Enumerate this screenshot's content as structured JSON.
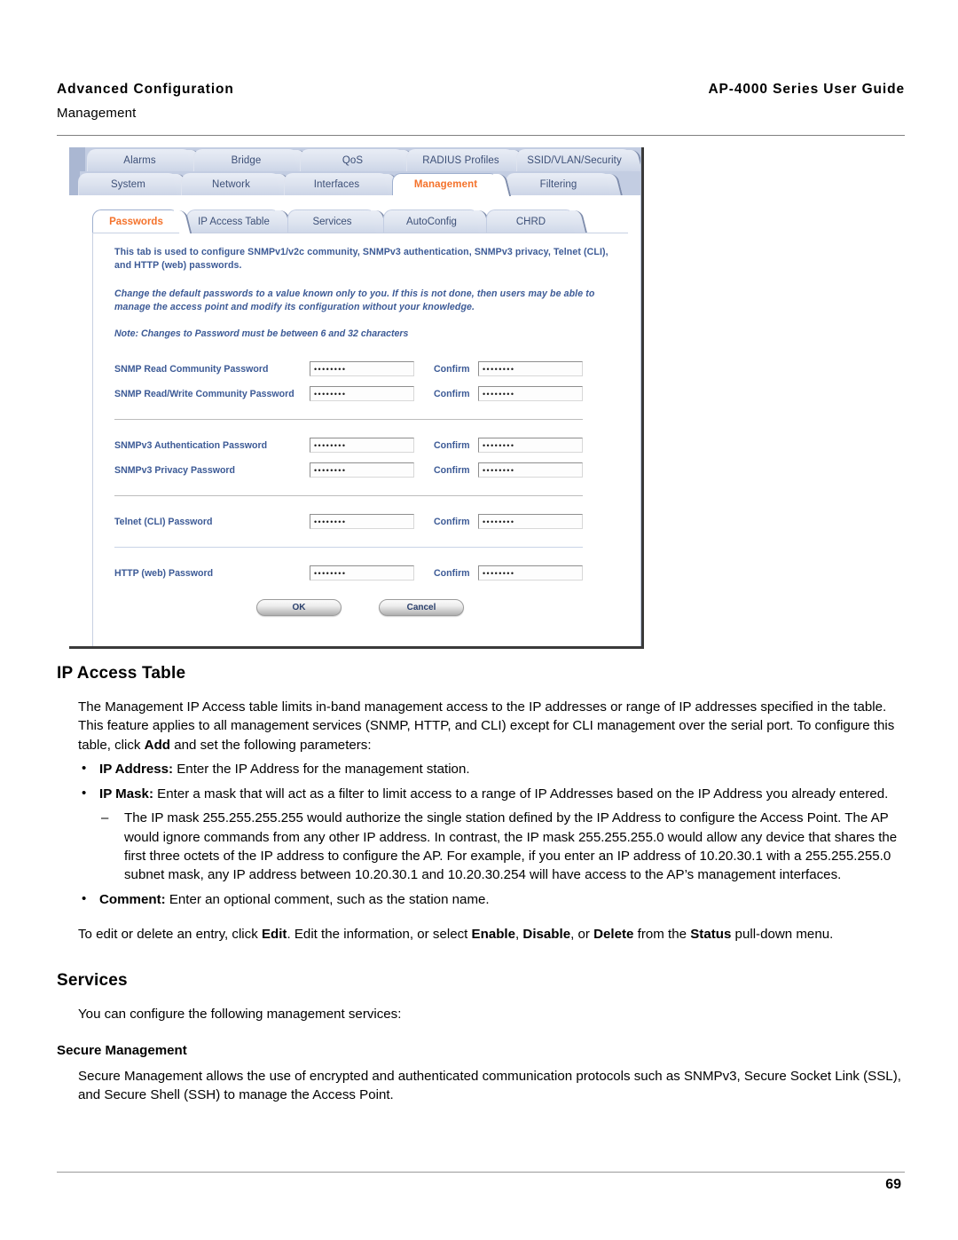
{
  "header": {
    "left_title": "Advanced Configuration",
    "left_sub": "Management",
    "right_title": "AP-4000 Series User Guide"
  },
  "screenshot": {
    "tabs_row1": [
      {
        "label": "Alarms",
        "active": false
      },
      {
        "label": "Bridge",
        "active": false
      },
      {
        "label": "QoS",
        "active": false
      },
      {
        "label": "RADIUS Profiles",
        "active": false
      },
      {
        "label": "SSID/VLAN/Security",
        "active": false
      }
    ],
    "tabs_row2": [
      {
        "label": "System",
        "active": false
      },
      {
        "label": "Network",
        "active": false
      },
      {
        "label": "Interfaces",
        "active": false
      },
      {
        "label": "Management",
        "active": true
      },
      {
        "label": "Filtering",
        "active": false
      }
    ],
    "subtabs": [
      {
        "label": "Passwords",
        "active": true
      },
      {
        "label": "IP Access Table",
        "active": false
      },
      {
        "label": "Services",
        "active": false
      },
      {
        "label": "AutoConfig",
        "active": false
      },
      {
        "label": "CHRD",
        "active": false
      }
    ],
    "description": "This tab is used to configure SNMPv1/v2c community, SNMPv3 authentication, SNMPv3 privacy, Telnet (CLI), and HTTP (web) passwords.",
    "warning": "Change the default passwords to a value known only to you. If this is not done, then users may be able to manage the access point and modify its configuration without your knowledge.",
    "note": "Note: Changes to Password must be between 6 and 32 characters",
    "confirm_label": "Confirm",
    "masked_value": "••••••••",
    "fields_group1": [
      {
        "label": "SNMP Read Community Password"
      },
      {
        "label": "SNMP Read/Write Community Password"
      }
    ],
    "fields_group2": [
      {
        "label": "SNMPv3 Authentication Password"
      },
      {
        "label": "SNMPv3 Privacy Password"
      }
    ],
    "fields_group3": [
      {
        "label": "Telnet (CLI) Password"
      }
    ],
    "fields_group4": [
      {
        "label": "HTTP (web) Password"
      }
    ],
    "buttons": {
      "ok": "OK",
      "cancel": "Cancel"
    },
    "accent_active_tab_color": "#f4722b",
    "tab_text_color": "#3c4f77",
    "form_label_color": "#3c5a96"
  },
  "content": {
    "ip_access_heading": "IP Access Table",
    "ip_access_intro_1": "The Management IP Access table limits in-band management access to the IP addresses or range of IP addresses specified in the table. This feature applies to all management services (SNMP, HTTP, and CLI) except for CLI management over the serial port. To configure this table, click ",
    "ip_access_intro_bold": "Add",
    "ip_access_intro_2": " and set the following parameters:",
    "bullet_ip_address_label": "IP Address:",
    "bullet_ip_address_text": " Enter the IP Address for the management station.",
    "bullet_ip_mask_label": "IP Mask:",
    "bullet_ip_mask_text": " Enter a mask that will act as a filter to limit access to a range of IP Addresses based on the IP Address you already entered.",
    "dash_ip_mask_text": "The IP mask 255.255.255.255 would authorize the single station defined by the IP Address to configure the Access Point. The AP would ignore commands from any other IP address. In contrast, the IP mask 255.255.255.0 would allow any device that shares the first three octets of the IP address to configure the AP. For example, if you enter an IP address of 10.20.30.1 with a 255.255.255.0 subnet mask, any IP address between 10.20.30.1 and 10.20.30.254 will have access to the AP’s management interfaces.",
    "bullet_comment_label": "Comment:",
    "bullet_comment_text": " Enter an optional comment, such as the station name.",
    "edit_para_1": "To edit or delete an entry, click ",
    "edit_bold_edit": "Edit",
    "edit_para_2": ". Edit the information, or select ",
    "edit_bold_enable": "Enable",
    "edit_para_3": ", ",
    "edit_bold_disable": "Disable",
    "edit_para_4": ", or ",
    "edit_bold_delete": "Delete",
    "edit_para_5": " from the ",
    "edit_bold_status": "Status",
    "edit_para_6": " pull-down menu.",
    "services_heading": "Services",
    "services_intro": "You can configure the following management services:",
    "secure_mgmt_heading": "Secure Management",
    "secure_mgmt_text": "Secure Management allows the use of encrypted and authenticated communication protocols such as SNMPv3, Secure Socket Link (SSL), and Secure Shell (SSH) to manage the Access Point."
  },
  "footer": {
    "page_number": "69"
  }
}
